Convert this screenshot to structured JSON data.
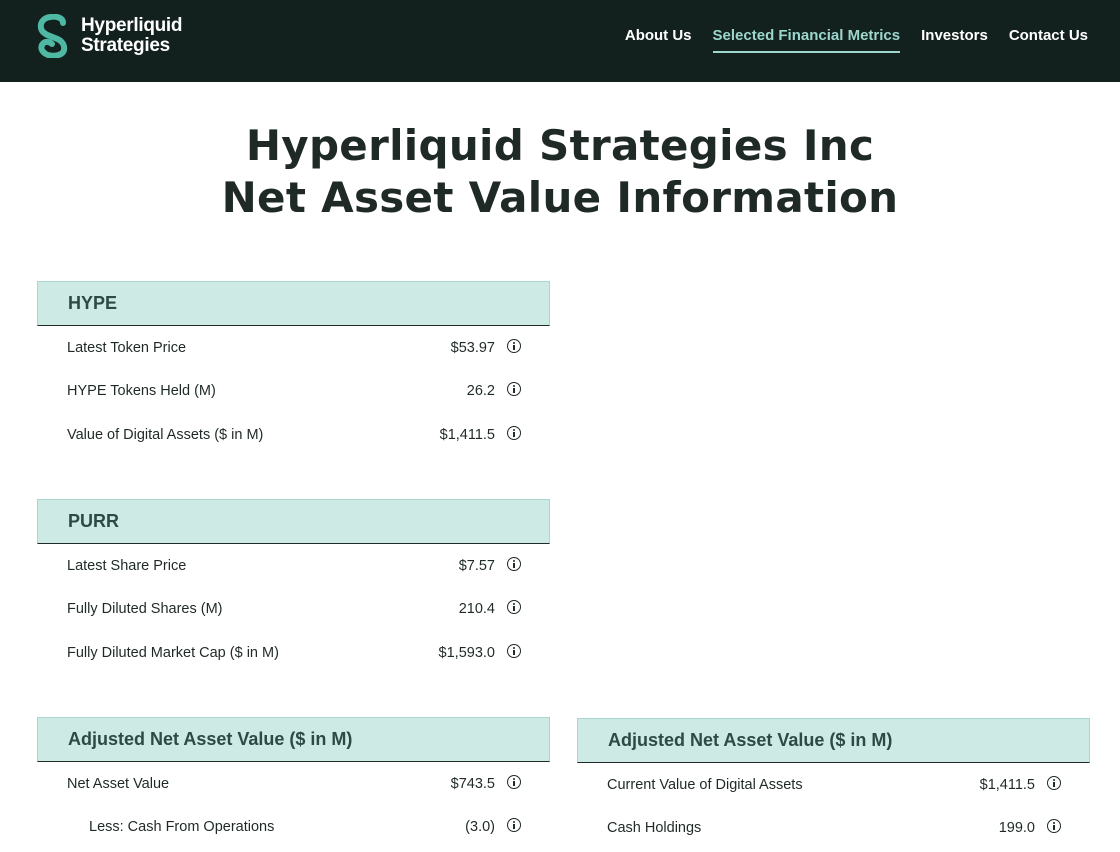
{
  "brand": {
    "line1": "Hyperliquid",
    "line2": "Strategies",
    "logo_icon": "hyperliquid-s-logo",
    "accent_color": "#4fb8a3"
  },
  "nav": {
    "items": [
      {
        "label": "About Us",
        "active": false
      },
      {
        "label": "Selected Financial Metrics",
        "active": true
      },
      {
        "label": "Investors",
        "active": false
      },
      {
        "label": "Contact Us",
        "active": false
      }
    ]
  },
  "page": {
    "title_line1": "Hyperliquid Strategies Inc",
    "title_line2": "Net Asset Value Information"
  },
  "hype": {
    "heading": "HYPE",
    "rows": [
      {
        "label": "Latest Token Price",
        "value": "$53.97"
      },
      {
        "label": "HYPE Tokens Held (M)",
        "value": "26.2"
      },
      {
        "label": "Value of Digital Assets ($ in M)",
        "value": "$1,411.5"
      }
    ]
  },
  "purr": {
    "heading": "PURR",
    "rows": [
      {
        "label": "Latest Share Price",
        "value": "$7.57"
      },
      {
        "label": "Fully Diluted Shares (M)",
        "value": "210.4"
      },
      {
        "label": "Fully Diluted Market Cap ($ in M)",
        "value": "$1,593.0"
      }
    ]
  },
  "adjusted_nav_left": {
    "heading": "Adjusted Net Asset Value ($ in M)",
    "rows": [
      {
        "label": "Net Asset Value",
        "value": "$743.5"
      },
      {
        "label": "Less: Cash From Operations",
        "value": "(3.0)"
      }
    ]
  },
  "adjusted_nav_right": {
    "heading": "Adjusted Net Asset Value ($ in M)",
    "rows": [
      {
        "label": "Current Value of Digital Assets",
        "value": "$1,411.5"
      },
      {
        "label": "Cash Holdings",
        "value": "199.0"
      }
    ]
  },
  "colors": {
    "nav_bg": "#13211e",
    "header_fill": "#cdeae4",
    "active_nav": "#9dd6cc"
  }
}
